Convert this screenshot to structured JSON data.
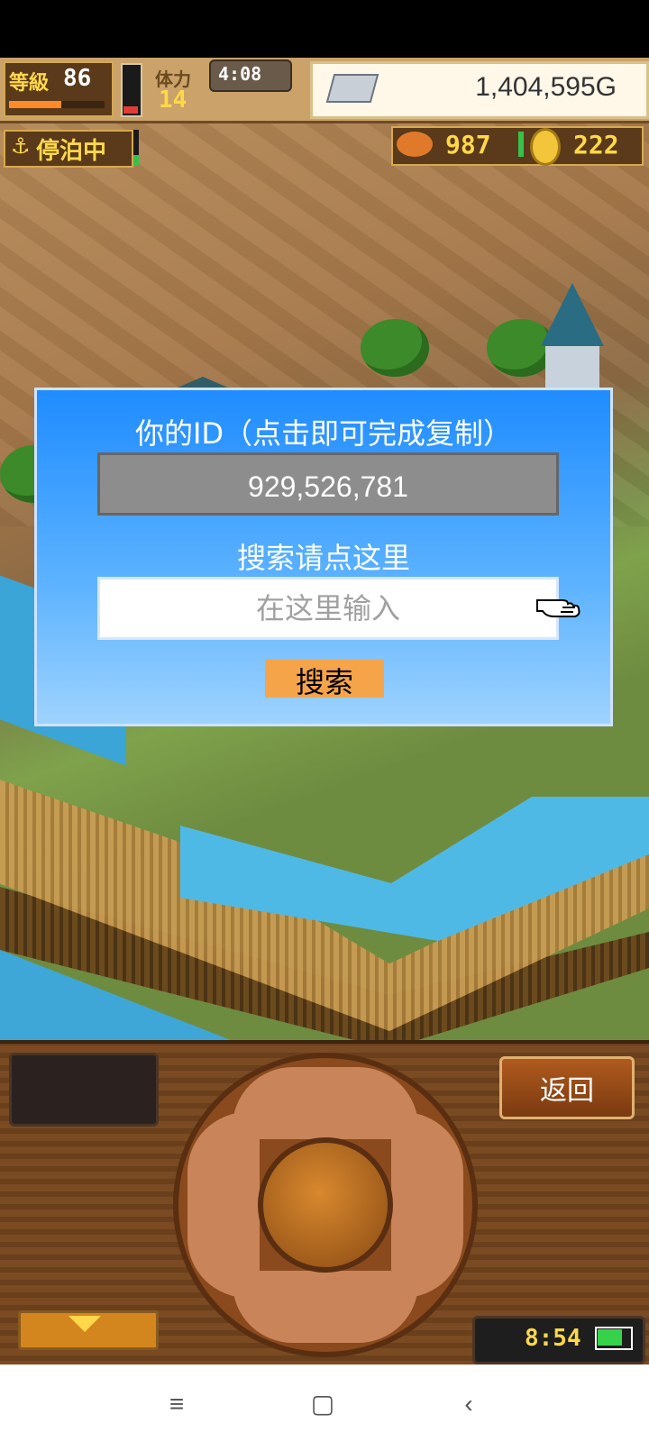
{
  "hud": {
    "level_label": "等級",
    "level": "86",
    "xp_progress": 0.55,
    "stamina_label": "体力",
    "stamina": "14",
    "stamina_level": 0.15,
    "timer": "4:08",
    "gold": "1,404,595G",
    "dock_status": "停泊中",
    "fish_count": "987",
    "coin_count": "222"
  },
  "dialog": {
    "title": "你的ID（点击即可完成复制）",
    "id_value": "929,526,781",
    "search_label": "搜索请点这里",
    "search_placeholder": "在这里输入",
    "search_button": "搜索"
  },
  "panel": {
    "back_button": "返回",
    "clock": "8:54",
    "battery_level": 0.85
  },
  "navbar": {
    "menu": "≡",
    "home": "▢",
    "back": "‹"
  },
  "colors": {
    "dialog_top": "#1f8cff",
    "dialog_bottom": "#9fd3ff",
    "search_button_bg": "#f5a44a",
    "hud_yellow": "#ffd84a"
  }
}
